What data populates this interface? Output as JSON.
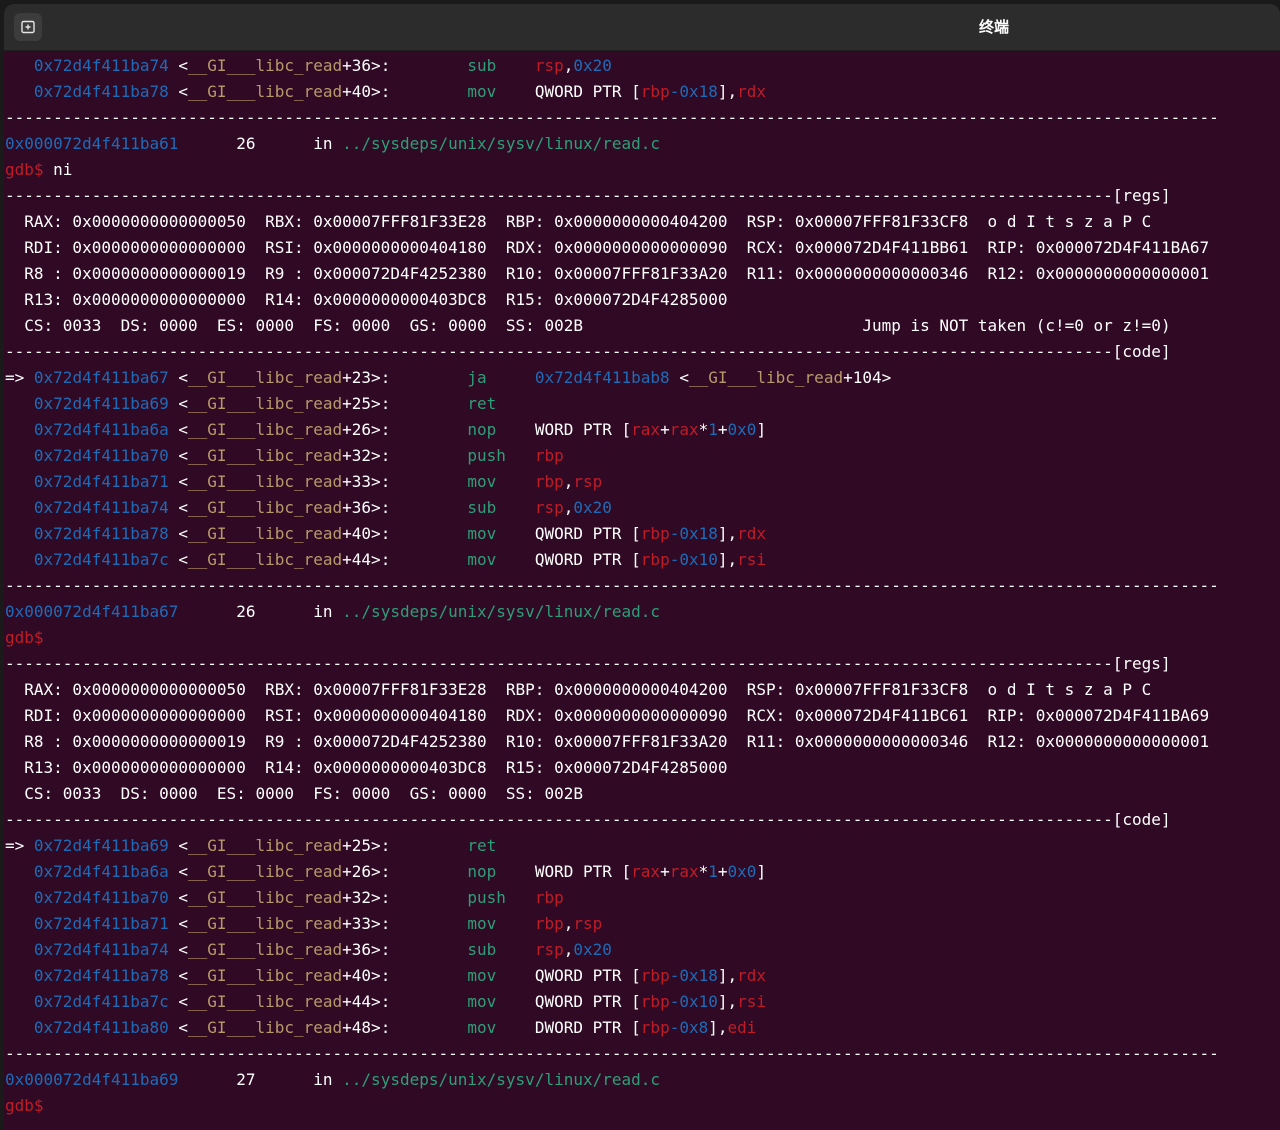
{
  "window": {
    "title": "终端",
    "new_tab_icon": "new-tab-icon"
  },
  "colors": {
    "background": "#300a24",
    "address": "#1e6bb8",
    "symbol": "#b89a6a",
    "mnemonic": "#2e9e78",
    "register": "#c01c28",
    "path": "#2e9e78"
  },
  "lines": [
    {
      "segs": [
        [
          "",
          "   "
        ],
        [
          "ad",
          "0x72d4f411ba74"
        ],
        [
          "",
          " <"
        ],
        [
          "sy",
          "__GI___libc_read"
        ],
        [
          "",
          "+36>:"
        ],
        [
          "",
          "        "
        ],
        [
          "mn",
          "sub"
        ],
        [
          "",
          "    "
        ],
        [
          "rg",
          "rsp"
        ],
        [
          "",
          ","
        ],
        [
          "nm",
          "0x20"
        ]
      ]
    },
    {
      "segs": [
        [
          "",
          "   "
        ],
        [
          "ad",
          "0x72d4f411ba78"
        ],
        [
          "",
          " <"
        ],
        [
          "sy",
          "__GI___libc_read"
        ],
        [
          "",
          "+40>:"
        ],
        [
          "",
          "        "
        ],
        [
          "mn",
          "mov"
        ],
        [
          "",
          "    QWORD PTR ["
        ],
        [
          "rg",
          "rbp"
        ],
        [
          "nm",
          "-0x18"
        ],
        [
          "",
          "],"
        ],
        [
          "rg",
          "rdx"
        ]
      ]
    },
    {
      "segs": [
        [
          "dash",
          "------------------------------------------------------------------------------------------------------------------------------"
        ]
      ]
    },
    {
      "segs": [
        [
          "ad",
          "0x000072d4f411ba61"
        ],
        [
          "",
          "      26      in "
        ],
        [
          "pth",
          "../sysdeps/unix/sysv/linux/read.c"
        ]
      ]
    },
    {
      "segs": [
        [
          "pr",
          "gdb$"
        ],
        [
          "",
          " ni"
        ]
      ]
    },
    {
      "segs": [
        [
          "dash",
          "-------------------------------------------------------------------------------------------------------------------[regs]"
        ]
      ]
    },
    {
      "segs": [
        [
          "",
          "  RAX: 0x0000000000000050  RBX: 0x00007FFF81F33E28  RBP: 0x0000000000404200  RSP: 0x00007FFF81F33CF8  o d I t s z a P C"
        ]
      ]
    },
    {
      "segs": [
        [
          "",
          "  RDI: 0x0000000000000000  RSI: 0x0000000000404180  RDX: 0x0000000000000090  RCX: 0x000072D4F411BB61  RIP: 0x000072D4F411BA67"
        ]
      ]
    },
    {
      "segs": [
        [
          "",
          "  R8 : 0x0000000000000019  R9 : 0x000072D4F4252380  R10: 0x00007FFF81F33A20  R11: 0x0000000000000346  R12: 0x0000000000000001"
        ]
      ]
    },
    {
      "segs": [
        [
          "",
          "  R13: 0x0000000000000000  R14: 0x0000000000403DC8  R15: 0x000072D4F4285000"
        ]
      ]
    },
    {
      "segs": [
        [
          "",
          "  CS: 0033  DS: 0000  ES: 0000  FS: 0000  GS: 0000  SS: 002B                             Jump is NOT taken (c!=0 or z!=0)"
        ]
      ]
    },
    {
      "segs": [
        [
          "dash",
          "-------------------------------------------------------------------------------------------------------------------[code]"
        ]
      ]
    },
    {
      "segs": [
        [
          "",
          "=> "
        ],
        [
          "ad",
          "0x72d4f411ba67"
        ],
        [
          "",
          " <"
        ],
        [
          "sy",
          "__GI___libc_read"
        ],
        [
          "",
          "+23>:"
        ],
        [
          "",
          "        "
        ],
        [
          "mn",
          "ja"
        ],
        [
          "",
          "     "
        ],
        [
          "ad",
          "0x72d4f411bab8"
        ],
        [
          "",
          " <"
        ],
        [
          "sy",
          "__GI___libc_read"
        ],
        [
          "",
          "+104>"
        ]
      ]
    },
    {
      "segs": [
        [
          "",
          "   "
        ],
        [
          "ad",
          "0x72d4f411ba69"
        ],
        [
          "",
          " <"
        ],
        [
          "sy",
          "__GI___libc_read"
        ],
        [
          "",
          "+25>:"
        ],
        [
          "",
          "        "
        ],
        [
          "mn",
          "ret"
        ]
      ]
    },
    {
      "segs": [
        [
          "",
          "   "
        ],
        [
          "ad",
          "0x72d4f411ba6a"
        ],
        [
          "",
          " <"
        ],
        [
          "sy",
          "__GI___libc_read"
        ],
        [
          "",
          "+26>:"
        ],
        [
          "",
          "        "
        ],
        [
          "mn",
          "nop"
        ],
        [
          "",
          "    WORD PTR ["
        ],
        [
          "rg",
          "rax"
        ],
        [
          "",
          "+"
        ],
        [
          "rg",
          "rax"
        ],
        [
          "",
          "*"
        ],
        [
          "nm",
          "1"
        ],
        [
          "",
          "+"
        ],
        [
          "nm",
          "0x0"
        ],
        [
          "",
          "]"
        ]
      ]
    },
    {
      "segs": [
        [
          "",
          "   "
        ],
        [
          "ad",
          "0x72d4f411ba70"
        ],
        [
          "",
          " <"
        ],
        [
          "sy",
          "__GI___libc_read"
        ],
        [
          "",
          "+32>:"
        ],
        [
          "",
          "        "
        ],
        [
          "mn",
          "push"
        ],
        [
          "",
          "   "
        ],
        [
          "rg",
          "rbp"
        ]
      ]
    },
    {
      "segs": [
        [
          "",
          "   "
        ],
        [
          "ad",
          "0x72d4f411ba71"
        ],
        [
          "",
          " <"
        ],
        [
          "sy",
          "__GI___libc_read"
        ],
        [
          "",
          "+33>:"
        ],
        [
          "",
          "        "
        ],
        [
          "mn",
          "mov"
        ],
        [
          "",
          "    "
        ],
        [
          "rg",
          "rbp"
        ],
        [
          "",
          ","
        ],
        [
          "rg",
          "rsp"
        ]
      ]
    },
    {
      "segs": [
        [
          "",
          "   "
        ],
        [
          "ad",
          "0x72d4f411ba74"
        ],
        [
          "",
          " <"
        ],
        [
          "sy",
          "__GI___libc_read"
        ],
        [
          "",
          "+36>:"
        ],
        [
          "",
          "        "
        ],
        [
          "mn",
          "sub"
        ],
        [
          "",
          "    "
        ],
        [
          "rg",
          "rsp"
        ],
        [
          "",
          ","
        ],
        [
          "nm",
          "0x20"
        ]
      ]
    },
    {
      "segs": [
        [
          "",
          "   "
        ],
        [
          "ad",
          "0x72d4f411ba78"
        ],
        [
          "",
          " <"
        ],
        [
          "sy",
          "__GI___libc_read"
        ],
        [
          "",
          "+40>:"
        ],
        [
          "",
          "        "
        ],
        [
          "mn",
          "mov"
        ],
        [
          "",
          "    QWORD PTR ["
        ],
        [
          "rg",
          "rbp"
        ],
        [
          "nm",
          "-0x18"
        ],
        [
          "",
          "],"
        ],
        [
          "rg",
          "rdx"
        ]
      ]
    },
    {
      "segs": [
        [
          "",
          "   "
        ],
        [
          "ad",
          "0x72d4f411ba7c"
        ],
        [
          "",
          " <"
        ],
        [
          "sy",
          "__GI___libc_read"
        ],
        [
          "",
          "+44>:"
        ],
        [
          "",
          "        "
        ],
        [
          "mn",
          "mov"
        ],
        [
          "",
          "    QWORD PTR ["
        ],
        [
          "rg",
          "rbp"
        ],
        [
          "nm",
          "-0x10"
        ],
        [
          "",
          "],"
        ],
        [
          "rg",
          "rsi"
        ]
      ]
    },
    {
      "segs": [
        [
          "dash",
          "------------------------------------------------------------------------------------------------------------------------------"
        ]
      ]
    },
    {
      "segs": [
        [
          "ad",
          "0x000072d4f411ba67"
        ],
        [
          "",
          "      26      in "
        ],
        [
          "pth",
          "../sysdeps/unix/sysv/linux/read.c"
        ]
      ]
    },
    {
      "segs": [
        [
          "pr",
          "gdb$"
        ]
      ]
    },
    {
      "segs": [
        [
          "dash",
          "-------------------------------------------------------------------------------------------------------------------[regs]"
        ]
      ]
    },
    {
      "segs": [
        [
          "",
          "  RAX: 0x0000000000000050  RBX: 0x00007FFF81F33E28  RBP: 0x0000000000404200  RSP: 0x00007FFF81F33CF8  o d I t s z a P C"
        ]
      ]
    },
    {
      "segs": [
        [
          "",
          "  RDI: 0x0000000000000000  RSI: 0x0000000000404180  RDX: 0x0000000000000090  RCX: 0x000072D4F411BC61  RIP: 0x000072D4F411BA69"
        ]
      ]
    },
    {
      "segs": [
        [
          "",
          "  R8 : 0x0000000000000019  R9 : 0x000072D4F4252380  R10: 0x00007FFF81F33A20  R11: 0x0000000000000346  R12: 0x0000000000000001"
        ]
      ]
    },
    {
      "segs": [
        [
          "",
          "  R13: 0x0000000000000000  R14: 0x0000000000403DC8  R15: 0x000072D4F4285000"
        ]
      ]
    },
    {
      "segs": [
        [
          "",
          "  CS: 0033  DS: 0000  ES: 0000  FS: 0000  GS: 0000  SS: 002B"
        ]
      ]
    },
    {
      "segs": [
        [
          "dash",
          "-------------------------------------------------------------------------------------------------------------------[code]"
        ]
      ]
    },
    {
      "segs": [
        [
          "",
          "=> "
        ],
        [
          "ad",
          "0x72d4f411ba69"
        ],
        [
          "",
          " <"
        ],
        [
          "sy",
          "__GI___libc_read"
        ],
        [
          "",
          "+25>:"
        ],
        [
          "",
          "        "
        ],
        [
          "mn",
          "ret"
        ]
      ]
    },
    {
      "segs": [
        [
          "",
          "   "
        ],
        [
          "ad",
          "0x72d4f411ba6a"
        ],
        [
          "",
          " <"
        ],
        [
          "sy",
          "__GI___libc_read"
        ],
        [
          "",
          "+26>:"
        ],
        [
          "",
          "        "
        ],
        [
          "mn",
          "nop"
        ],
        [
          "",
          "    WORD PTR ["
        ],
        [
          "rg",
          "rax"
        ],
        [
          "",
          "+"
        ],
        [
          "rg",
          "rax"
        ],
        [
          "",
          "*"
        ],
        [
          "nm",
          "1"
        ],
        [
          "",
          "+"
        ],
        [
          "nm",
          "0x0"
        ],
        [
          "",
          "]"
        ]
      ]
    },
    {
      "segs": [
        [
          "",
          "   "
        ],
        [
          "ad",
          "0x72d4f411ba70"
        ],
        [
          "",
          " <"
        ],
        [
          "sy",
          "__GI___libc_read"
        ],
        [
          "",
          "+32>:"
        ],
        [
          "",
          "        "
        ],
        [
          "mn",
          "push"
        ],
        [
          "",
          "   "
        ],
        [
          "rg",
          "rbp"
        ]
      ]
    },
    {
      "segs": [
        [
          "",
          "   "
        ],
        [
          "ad",
          "0x72d4f411ba71"
        ],
        [
          "",
          " <"
        ],
        [
          "sy",
          "__GI___libc_read"
        ],
        [
          "",
          "+33>:"
        ],
        [
          "",
          "        "
        ],
        [
          "mn",
          "mov"
        ],
        [
          "",
          "    "
        ],
        [
          "rg",
          "rbp"
        ],
        [
          "",
          ","
        ],
        [
          "rg",
          "rsp"
        ]
      ]
    },
    {
      "segs": [
        [
          "",
          "   "
        ],
        [
          "ad",
          "0x72d4f411ba74"
        ],
        [
          "",
          " <"
        ],
        [
          "sy",
          "__GI___libc_read"
        ],
        [
          "",
          "+36>:"
        ],
        [
          "",
          "        "
        ],
        [
          "mn",
          "sub"
        ],
        [
          "",
          "    "
        ],
        [
          "rg",
          "rsp"
        ],
        [
          "",
          ","
        ],
        [
          "nm",
          "0x20"
        ]
      ]
    },
    {
      "segs": [
        [
          "",
          "   "
        ],
        [
          "ad",
          "0x72d4f411ba78"
        ],
        [
          "",
          " <"
        ],
        [
          "sy",
          "__GI___libc_read"
        ],
        [
          "",
          "+40>:"
        ],
        [
          "",
          "        "
        ],
        [
          "mn",
          "mov"
        ],
        [
          "",
          "    QWORD PTR ["
        ],
        [
          "rg",
          "rbp"
        ],
        [
          "nm",
          "-0x18"
        ],
        [
          "",
          "],"
        ],
        [
          "rg",
          "rdx"
        ]
      ]
    },
    {
      "segs": [
        [
          "",
          "   "
        ],
        [
          "ad",
          "0x72d4f411ba7c"
        ],
        [
          "",
          " <"
        ],
        [
          "sy",
          "__GI___libc_read"
        ],
        [
          "",
          "+44>:"
        ],
        [
          "",
          "        "
        ],
        [
          "mn",
          "mov"
        ],
        [
          "",
          "    QWORD PTR ["
        ],
        [
          "rg",
          "rbp"
        ],
        [
          "nm",
          "-0x10"
        ],
        [
          "",
          "],"
        ],
        [
          "rg",
          "rsi"
        ]
      ]
    },
    {
      "segs": [
        [
          "",
          "   "
        ],
        [
          "ad",
          "0x72d4f411ba80"
        ],
        [
          "",
          " <"
        ],
        [
          "sy",
          "__GI___libc_read"
        ],
        [
          "",
          "+48>:"
        ],
        [
          "",
          "        "
        ],
        [
          "mn",
          "mov"
        ],
        [
          "",
          "    DWORD PTR ["
        ],
        [
          "rg",
          "rbp"
        ],
        [
          "nm",
          "-0x8"
        ],
        [
          "",
          "],"
        ],
        [
          "rg",
          "edi"
        ]
      ]
    },
    {
      "segs": [
        [
          "dash",
          "------------------------------------------------------------------------------------------------------------------------------"
        ]
      ]
    },
    {
      "segs": [
        [
          "ad",
          "0x000072d4f411ba69"
        ],
        [
          "",
          "      27      in "
        ],
        [
          "pth",
          "../sysdeps/unix/sysv/linux/read.c"
        ]
      ]
    },
    {
      "segs": [
        [
          "pr",
          "gdb$"
        ]
      ]
    }
  ]
}
